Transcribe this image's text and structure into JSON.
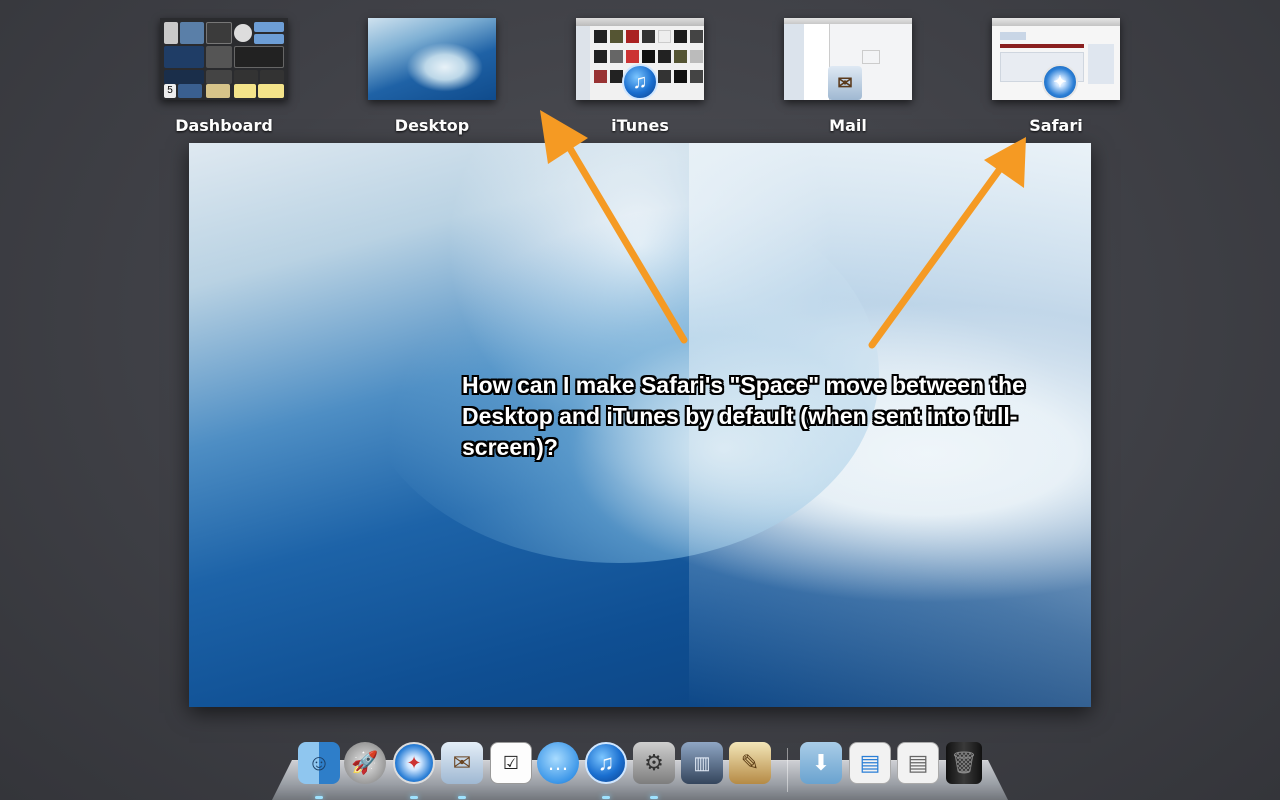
{
  "spaces": [
    {
      "label": "Dashboard",
      "icon": "dashboard-thumbnail"
    },
    {
      "label": "Desktop",
      "icon": "desktop-thumbnail"
    },
    {
      "label": "iTunes",
      "icon": "itunes-icon"
    },
    {
      "label": "Mail",
      "icon": "mail-icon"
    },
    {
      "label": "Safari",
      "icon": "safari-icon"
    }
  ],
  "annotation": {
    "text": "How can I make Safari's \"Space\" move between the Desktop and iTunes by default (when sent into full-screen)?",
    "arrow_color": "#f59a23"
  },
  "dock": {
    "items": [
      {
        "name": "finder-icon"
      },
      {
        "name": "launchpad-icon"
      },
      {
        "name": "safari-icon"
      },
      {
        "name": "mail-icon"
      },
      {
        "name": "reminders-icon"
      },
      {
        "name": "messages-icon"
      },
      {
        "name": "itunes-icon"
      },
      {
        "name": "system-preferences-icon"
      },
      {
        "name": "mission-control-icon"
      },
      {
        "name": "preview-icon"
      },
      {
        "name": "downloads-folder-icon"
      },
      {
        "name": "document-stack-icon"
      },
      {
        "name": "document-stack-icon"
      },
      {
        "name": "trash-icon"
      }
    ]
  },
  "colors": {
    "background": "#3f4046",
    "label": "#ffffff",
    "dock_light": "#9fe3ff"
  }
}
